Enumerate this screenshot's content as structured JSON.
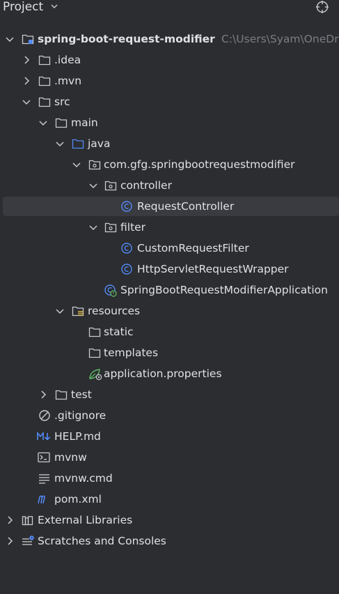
{
  "header": {
    "title": "Project"
  },
  "root": {
    "label": "spring-boot-request-modifier",
    "path": "C:\\Users\\Syam\\OneDr"
  },
  "tree": {
    "idea": ".idea",
    "mvn": ".mvn",
    "src": "src",
    "main": "main",
    "java": "java",
    "package": "com.gfg.springbootrequestmodifier",
    "controller": "controller",
    "request_controller": "RequestController",
    "filter": "filter",
    "custom_request_filter": "CustomRequestFilter",
    "http_wrapper": "HttpServletRequestWrapper",
    "application": "SpringBootRequestModifierApplication",
    "resources": "resources",
    "static": "static",
    "templates": "templates",
    "application_properties": "application.properties",
    "test": "test",
    "gitignore": ".gitignore",
    "help": "HELP.md",
    "mvnw": "mvnw",
    "mvnw_cmd": "mvnw.cmd",
    "pom": "pom.xml",
    "external_libraries": "External Libraries",
    "scratches": "Scratches and Consoles"
  },
  "colors": {
    "background": "#2b2d30",
    "selection": "#393b40",
    "text": "#dfe1e5",
    "muted": "#7a7e85",
    "class_icon": "#548af7",
    "spring_green": "#5fb865"
  }
}
